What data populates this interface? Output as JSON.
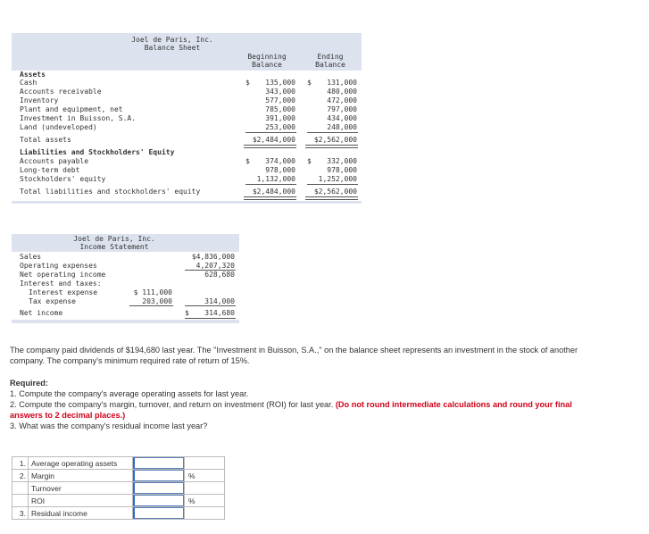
{
  "balance_sheet": {
    "company": "Joel de Paris, Inc.",
    "title": "Balance Sheet",
    "col_begin_1": "Beginning",
    "col_begin_2": "Balance",
    "col_end_1": "Ending",
    "col_end_2": "Balance",
    "assets_heading": "Assets",
    "assets": [
      {
        "label": "Cash",
        "begin": "135,000",
        "end": "131,000"
      },
      {
        "label": "Accounts receivable",
        "begin": "343,000",
        "end": "480,000"
      },
      {
        "label": "Inventory",
        "begin": "577,000",
        "end": "472,000"
      },
      {
        "label": "Plant and equipment, net",
        "begin": "785,000",
        "end": "797,000"
      },
      {
        "label": "Investment in Buisson, S.A.",
        "begin": "391,000",
        "end": "434,000"
      },
      {
        "label": "Land (undeveloped)",
        "begin": "253,000",
        "end": "248,000"
      }
    ],
    "dollar": "$",
    "total_assets_label": "Total assets",
    "total_assets_begin": "$2,484,000",
    "total_assets_end": "$2,562,000",
    "liab_heading": "Liabilities and Stockholders' Equity",
    "liabilities": [
      {
        "label": "Accounts payable",
        "begin": "374,000",
        "end": "332,000"
      },
      {
        "label": "Long-term debt",
        "begin": "978,000",
        "end": "978,000"
      },
      {
        "label": "Stockholders' equity",
        "begin": "1,132,000",
        "end": "1,252,000"
      }
    ],
    "total_liab_label": "Total liabilities and stockholders' equity",
    "total_liab_begin": "$2,484,000",
    "total_liab_end": "$2,562,000"
  },
  "income_statement": {
    "company": "Joel de Paris, Inc.",
    "title": "Income Statement",
    "sales_label": "Sales",
    "sales": "$4,836,000",
    "opex_label": "Operating expenses",
    "opex": "4,207,320",
    "noi_label": "Net operating income",
    "noi": "628,680",
    "interest_taxes_label": "Interest and taxes:",
    "interest_label": "Interest expense",
    "interest": "$ 111,000",
    "tax_label": "Tax expense",
    "tax": "203,000",
    "it_total": "314,000",
    "net_income_label": "Net income",
    "net_income_dollar": "$",
    "net_income": "314,680"
  },
  "problem": {
    "paragraph": "The company paid dividends of $194,680 last year. The \"Investment in Buisson, S.A.,\" on the balance sheet represents an investment in the stock of another company. The company's minimum required rate of return of 15%.",
    "required_label": "Required:",
    "req1": "1. Compute the company's average operating assets for last year.",
    "req2": "2. Compute the company's margin, turnover, and return on investment (ROI) for last year.",
    "req2_note": "(Do not round intermediate calculations and round your final answers to 2 decimal places.)",
    "req3": "3. What was the company's residual income last year?"
  },
  "answer_table": {
    "rows": [
      {
        "num": "1.",
        "label": "Average operating assets",
        "unit": ""
      },
      {
        "num": "2.",
        "label": "Margin",
        "unit": "%"
      },
      {
        "num": "",
        "label": "Turnover",
        "unit": ""
      },
      {
        "num": "",
        "label": "ROI",
        "unit": "%"
      },
      {
        "num": "3.",
        "label": "Residual income",
        "unit": ""
      }
    ]
  }
}
